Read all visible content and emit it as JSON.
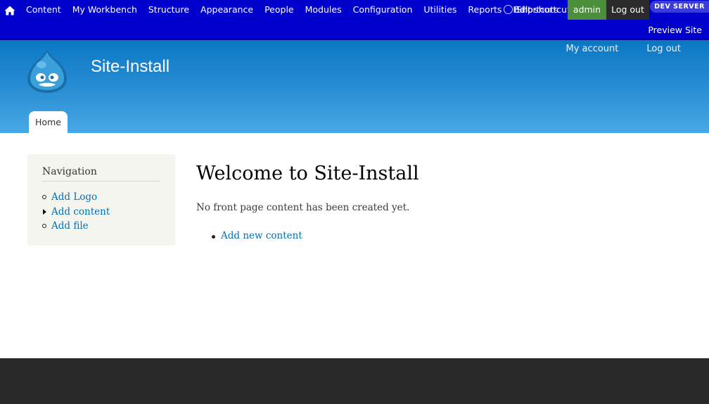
{
  "toolbar": {
    "home_icon": "home-icon",
    "menu": [
      "Content",
      "My Workbench",
      "Structure",
      "Appearance",
      "People",
      "Modules",
      "Configuration",
      "Utilities",
      "Reports",
      "Help"
    ],
    "shortcuts_label": "Edit shortcuts",
    "shortcuts_overlap": "Shortcuts",
    "user_label": "admin",
    "logout_label": "Log out",
    "dev_badge": "DEV SERVER",
    "preview_label": "Preview Site",
    "colors": {
      "background": "#0000cc",
      "user": "#4b8f3a",
      "logout": "#2b2b2b"
    }
  },
  "header": {
    "site_name": "Site-Install",
    "logo_icon": "drupal-drop-logo",
    "secondary_menu": [
      "My account",
      "Log out"
    ],
    "tabs": [
      "Home"
    ],
    "colors": {
      "gradient_top": "#0b77c4",
      "gradient_bottom": "#48a9e6"
    }
  },
  "sidebar": {
    "title": "Navigation",
    "items": [
      {
        "label": "Add Logo",
        "bullet": "open-circle"
      },
      {
        "label": "Add content",
        "bullet": "collapsed-arrow"
      },
      {
        "label": "Add file",
        "bullet": "open-circle"
      }
    ]
  },
  "main": {
    "title": "Welcome to Site-Install",
    "intro": "No front page content has been created yet.",
    "links": [
      "Add new content"
    ]
  },
  "footer": {
    "color": "#292929"
  }
}
